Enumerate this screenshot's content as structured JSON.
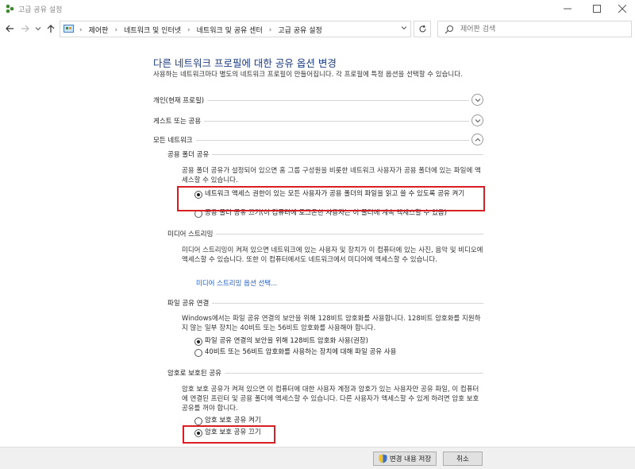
{
  "window": {
    "title": "고급 공유 설정"
  },
  "nav": {
    "breadcrumbs": [
      "제어판",
      "네트워크 및 인터넷",
      "네트워크 및 공유 센터",
      "고급 공유 설정"
    ],
    "search_placeholder": "제어판 검색"
  },
  "main": {
    "heading": "다른 네트워크 프로필에 대한 공유 옵션 변경",
    "description": "사용하는 네트워크마다 별도의 네트워크 프로필이 만들어집니다. 각 프로필에 특정 옵션을 선택할 수 있습니다.",
    "profiles": [
      {
        "label": "개인(현재 프로필)",
        "expanded": false
      },
      {
        "label": "게스트 또는 공용",
        "expanded": false
      },
      {
        "label": "모든 네트워크",
        "expanded": true
      }
    ],
    "public_folder": {
      "title": "공용 폴더 공유",
      "text": "공용 폴더 공유가 설정되어 있으면 홈 그룹 구성원을 비롯한 네트워크 사용자가 공용 폴더에 있는 파일에 액세스할 수 있습니다.",
      "options": [
        {
          "label": "네트워크 액세스 권한이 있는 모든 사용자가 공용 폴더의 파일을 읽고 쓸 수 있도록 공유 켜기",
          "checked": true
        },
        {
          "label": "공용 폴더 공유 끄기(이 컴퓨터에 로그온한 사용자는 이 폴더에 계속 액세스할 수 있음)",
          "checked": false
        }
      ]
    },
    "media_streaming": {
      "title": "미디어 스트리밍",
      "text": "미디어 스트리밍이 켜져 있으면 네트워크에 있는 사용자 및 장치가 이 컴퓨터에 있는 사진, 음악 및 비디오에 액세스할 수 있습니다. 또한 이 컴퓨터에서도 네트워크에서 미디어에 액세스할 수 있습니다.",
      "link": "미디어 스트리밍 옵션 선택..."
    },
    "file_sharing": {
      "title": "파일 공유 연결",
      "text": "Windows에서는 파일 공유 연결의 보안을 위해 128비트 암호화를 사용합니다. 128비트 암호화를 지원하지 않는 일부 장치는 40비트 또는 56비트 암호화를 사용해야 합니다.",
      "options": [
        {
          "label": "파일 공유 연결의 보안을 위해 128비트 암호화 사용(권장)",
          "checked": true
        },
        {
          "label": "40비트 또는 56비트 암호화를 사용하는 장치에 대해 파일 공유 사용",
          "checked": false
        }
      ]
    },
    "password_sharing": {
      "title": "암호로 보호된 공유",
      "text": "암호 보호 공유가 켜져 있으면 이 컴퓨터에 대한 사용자 계정과 암호가 있는 사용자만 공유 파일, 이 컴퓨터에 연결된 프린터 및 공용 폴더에 액세스할 수 있습니다. 다른 사용자가 액세스할 수 있게 하려면 암호 보호 공유를 꺼야 합니다.",
      "options": [
        {
          "label": "암호 보호 공유 켜기",
          "checked": false
        },
        {
          "label": "암호 보호 공유 끄기",
          "checked": true
        }
      ]
    }
  },
  "footer": {
    "save_label": "변경 내용 저장",
    "cancel_label": "취소"
  },
  "colors": {
    "heading": "#1c3c85",
    "link": "#1e5bc6",
    "highlight": "#d91f26"
  }
}
